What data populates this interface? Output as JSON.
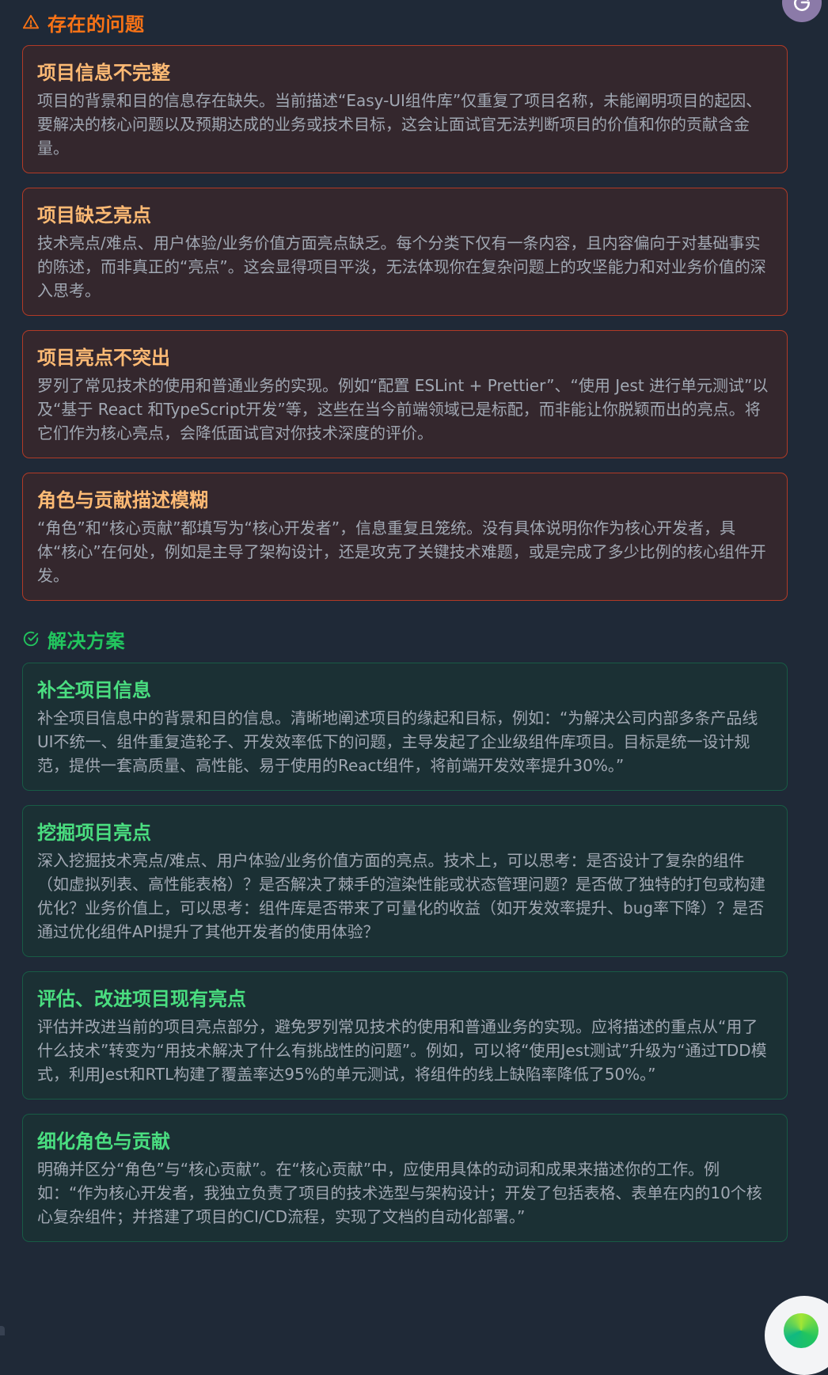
{
  "issues": {
    "heading": "存在的问题",
    "items": [
      {
        "title": "项目信息不完整",
        "body": "项目的背景和目的信息存在缺失。当前描述“Easy-UI组件库”仅重复了项目名称，未能阐明项目的起因、要解决的核心问题以及预期达成的业务或技术目标，这会让面试官无法判断项目的价值和你的贡献含金量。"
      },
      {
        "title": "项目缺乏亮点",
        "body": "技术亮点/难点、用户体验/业务价值方面亮点缺乏。每个分类下仅有一条内容，且内容偏向于对基础事实的陈述，而非真正的“亮点”。这会显得项目平淡，无法体现你在复杂问题上的攻坚能力和对业务价值的深入思考。"
      },
      {
        "title": "项目亮点不突出",
        "body": "罗列了常见技术的使用和普通业务的实现。例如“配置 ESLint + Prettier”、“使用 Jest 进行单元测试”以及“基于 React 和TypeScript开发”等，这些在当今前端领域已是标配，而非能让你脱颖而出的亮点。将它们作为核心亮点，会降低面试官对你技术深度的评价。"
      },
      {
        "title": "角色与贡献描述模糊",
        "body": "“角色”和“核心贡献”都填写为“核心开发者”，信息重复且笼统。没有具体说明你作为核心开发者，具体“核心”在何处，例如是主导了架构设计，还是攻克了关键技术难题，或是完成了多少比例的核心组件开发。"
      }
    ]
  },
  "solutions": {
    "heading": "解决方案",
    "items": [
      {
        "title": "补全项目信息",
        "body": "补全项目信息中的背景和目的信息。清晰地阐述项目的缘起和目标，例如：“为解决公司内部多条产品线UI不统一、组件重复造轮子、开发效率低下的问题，主导发起了企业级组件库项目。目标是统一设计规范，提供一套高质量、高性能、易于使用的React组件，将前端开发效率提升30%。”"
      },
      {
        "title": "挖掘项目亮点",
        "body": "深入挖掘技术亮点/难点、用户体验/业务价值方面的亮点。技术上，可以思考：是否设计了复杂的组件（如虚拟列表、高性能表格）？是否解决了棘手的渲染性能或状态管理问题？是否做了独特的打包或构建优化？业务价值上，可以思考：组件库是否带来了可量化的收益（如开发效率提升、bug率下降）？是否通过优化组件API提升了其他开发者的使用体验？"
      },
      {
        "title": "评估、改进项目现有亮点",
        "body": "评估并改进当前的项目亮点部分，避免罗列常见技术的使用和普通业务的实现。应将描述的重点从“用了什么技术”转变为“用技术解决了什么有挑战性的问题”。例如，可以将“使用Jest测试”升级为“通过TDD模式，利用Jest和RTL构建了覆盖率达95%的单元测试，将组件的线上缺陷率降低了50%。”"
      },
      {
        "title": "细化角色与贡献",
        "body": "明确并区分“角色”与“核心贡献”。在“核心贡献”中，应使用具体的动词和成果来描述你的工作。例如：“作为核心开发者，我独立负责了项目的技术选型与架构设计；开发了包括表格、表单在内的10个核心复杂组件；并搭建了项目的CI/CD流程，实现了文档的自动化部署。”"
      }
    ]
  },
  "icons": {
    "issues": "warning-triangle-icon",
    "solutions": "check-circle-icon",
    "avatar": "user-avatar-icon",
    "fab": "assistant-fab-icon"
  },
  "colors": {
    "background": "#1f2937",
    "issue_accent": "#f97316",
    "issue_title": "#fdba74",
    "issue_border": "#b13a26",
    "solution_accent": "#22c55e",
    "solution_title": "#4ade80",
    "solution_border": "#185b45",
    "body_text": "#a1a8b3"
  }
}
